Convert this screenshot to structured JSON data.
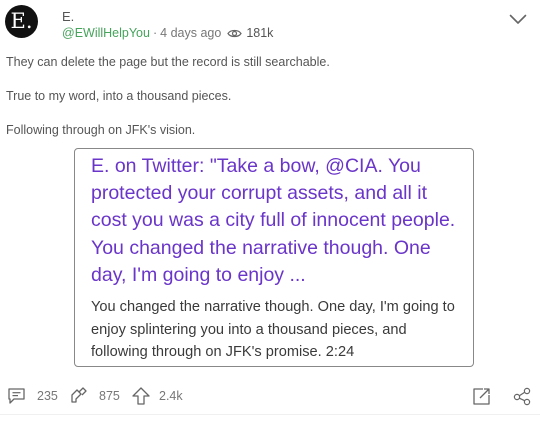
{
  "post": {
    "avatar_letter": "E.",
    "author_name": "E.",
    "handle": "@EWillHelpYou",
    "separator": "·",
    "time": "4 days ago",
    "views": "181k",
    "paragraphs": [
      "They can delete the page but the record is still searchable.",
      "True to my word, into a thousand pieces.",
      "Following through on JFK's vision."
    ]
  },
  "link_card": {
    "title": "E. on Twitter: \"Take a bow, @CIA. You protected your corrupt assets, and all it cost you was a city full of innocent people. You changed the narrative though. One day, I'm going to enjoy ...",
    "description": "You changed the narrative though. One day, I'm going to enjoy splintering you into a thousand pieces, and following through on JFK's promise. 2:24"
  },
  "actions": {
    "comments": "235",
    "shares": "875",
    "upvotes": "2.4k"
  },
  "icons": {
    "menu": "chevron-down-icon",
    "views": "eye-icon",
    "comments": "comment-icon",
    "shares": "share-arrows-icon",
    "upvote": "arrow-up-icon",
    "open": "open-external-icon",
    "share": "share-icon"
  },
  "colors": {
    "handle": "#46a35b",
    "card_title": "#6a35c9",
    "avatar_bg": "#111111"
  }
}
